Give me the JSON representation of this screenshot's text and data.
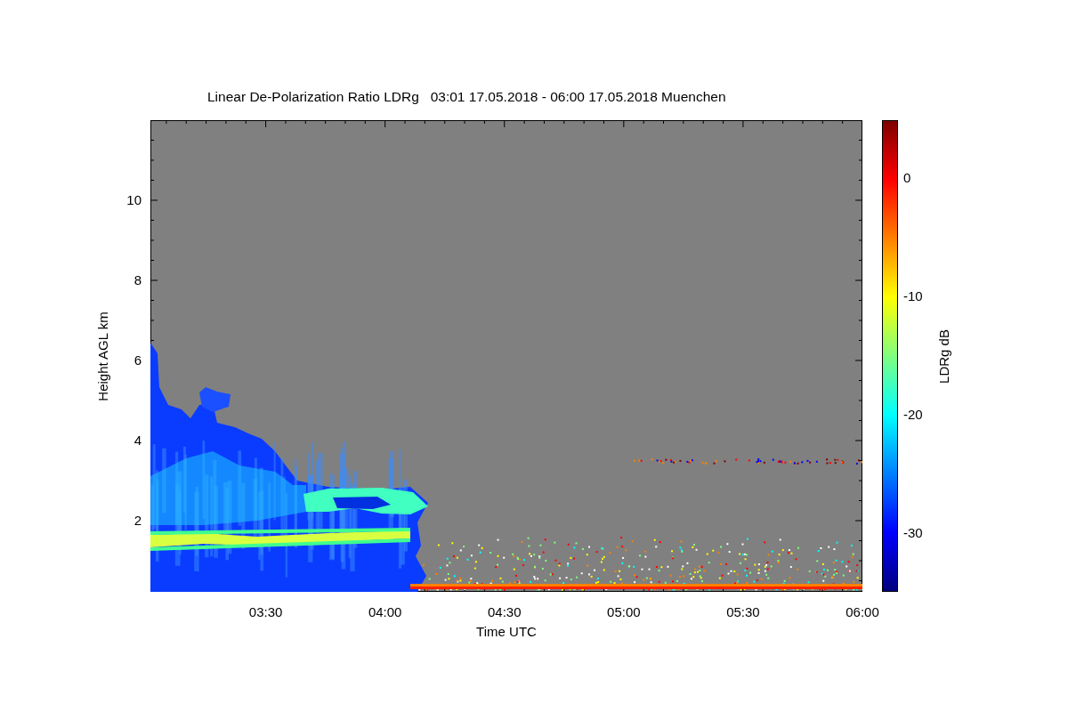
{
  "title": "Linear De-Polarization Ratio LDRg   03:01 17.05.2018 - 06:00 17.05.2018 Muenchen",
  "plot": {
    "ylabel": "Height AGL km",
    "xlabel": "Time UTC",
    "yticks": [
      "10",
      "8",
      "6",
      "4",
      "2"
    ],
    "xticks": [
      "03:30",
      "04:00",
      "04:30",
      "05:00",
      "05:30",
      "06:00"
    ]
  },
  "colorbar": {
    "label": "LDRg dB",
    "ticks": [
      "0",
      "-10",
      "-20",
      "-30"
    ]
  }
}
